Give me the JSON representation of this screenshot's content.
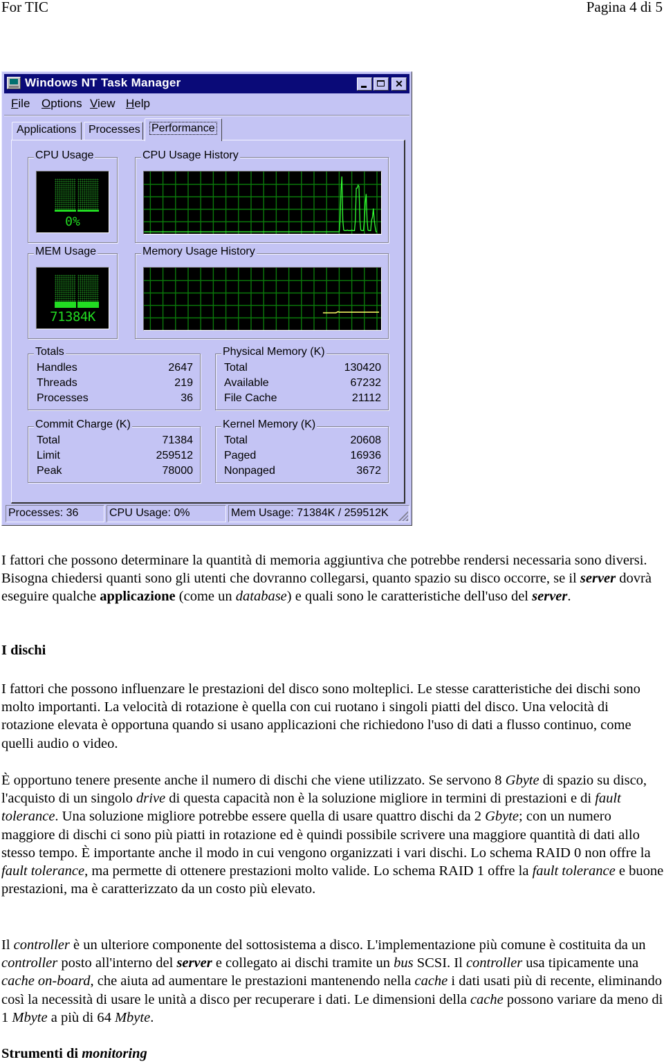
{
  "page_header": {
    "left": "For TIC",
    "right": "Pagina 4 di 5"
  },
  "task_manager": {
    "title": "Windows NT Task Manager",
    "title_buttons": [
      "minimize",
      "maximize",
      "close"
    ],
    "menu": [
      {
        "accel": "F",
        "rest": "ile"
      },
      {
        "accel": "O",
        "rest": "ptions"
      },
      {
        "accel": "V",
        "rest": "iew"
      },
      {
        "accel": "H",
        "rest": "elp"
      }
    ],
    "tabs": [
      "Applications",
      "Processes",
      "Performance"
    ],
    "active_tab": "Performance",
    "cpu_usage": {
      "label": "CPU Usage",
      "value_text": "0%",
      "percent": 0
    },
    "cpu_history": {
      "label": "CPU Usage History",
      "line_color": "#33ff33",
      "recent_samples_percent": [
        0,
        0,
        0,
        0,
        0,
        0,
        0,
        0,
        0,
        0,
        0,
        0,
        0,
        0,
        0,
        0,
        0,
        0,
        0,
        0,
        0,
        0,
        0,
        0,
        0,
        0,
        0,
        0,
        0,
        0,
        0,
        0,
        0,
        0,
        0,
        0,
        0,
        0,
        0,
        0,
        0,
        0,
        0,
        0,
        0,
        0,
        0,
        0,
        0,
        0,
        0,
        0,
        0,
        0,
        0,
        0,
        0,
        0,
        0,
        0,
        0,
        0,
        0,
        0,
        0,
        0,
        0,
        0,
        0,
        0,
        0,
        0,
        0,
        0,
        0,
        0,
        0,
        0,
        0,
        0,
        0,
        0,
        0,
        0,
        0,
        0,
        0,
        0,
        0,
        0,
        0,
        0,
        0,
        0,
        0,
        0,
        0,
        0,
        0,
        0,
        0,
        0,
        0,
        0,
        0,
        0,
        0,
        0,
        0,
        0,
        0,
        0,
        0,
        0,
        0,
        0,
        0,
        0,
        0,
        0,
        0,
        0,
        0,
        0,
        0,
        0,
        0,
        0,
        0,
        0,
        0,
        0,
        0,
        0,
        0,
        0,
        0,
        0,
        0,
        0,
        0,
        0,
        0,
        0,
        0,
        0,
        0,
        0,
        0,
        0,
        0,
        0,
        0,
        0,
        0,
        0,
        0,
        0,
        0,
        0,
        0,
        0,
        0,
        0,
        0,
        0,
        0,
        0,
        0,
        0,
        0,
        0,
        0,
        0,
        0,
        0,
        0,
        0,
        0,
        0,
        0,
        0,
        0,
        0,
        0,
        0,
        0,
        0,
        0,
        0,
        0,
        0,
        0,
        0,
        0,
        0,
        0,
        0,
        0,
        0,
        0,
        0,
        0,
        0,
        0,
        0,
        0,
        0,
        0,
        0,
        0,
        0,
        0,
        0,
        0,
        0,
        0,
        0,
        0,
        0,
        0,
        0,
        0,
        0,
        0,
        0,
        0,
        0,
        0,
        0,
        0,
        0,
        0,
        0,
        0,
        0,
        0,
        0,
        0,
        0,
        0,
        0,
        0,
        0,
        0,
        0,
        0,
        0,
        0,
        0,
        0,
        0,
        0,
        0,
        0,
        0,
        0,
        0,
        0,
        0,
        0,
        0,
        0,
        0,
        0,
        0,
        0,
        0,
        0,
        0,
        0,
        0,
        0,
        0,
        0,
        0,
        0,
        0,
        0,
        0,
        0,
        0,
        0,
        0,
        0,
        0,
        0,
        0,
        0,
        0,
        0,
        0,
        0,
        0,
        0,
        0,
        0,
        20,
        70,
        95,
        20,
        3,
        2,
        2,
        2,
        3,
        2,
        2,
        2,
        2,
        3,
        2,
        2,
        2,
        20,
        75,
        75,
        80,
        78,
        20,
        3,
        2,
        2,
        2,
        20,
        50,
        65,
        20,
        3,
        2,
        2,
        2,
        20,
        25,
        40,
        20,
        8,
        0,
        0
      ]
    },
    "mem_usage": {
      "label": "MEM Usage",
      "value_text": "71384K",
      "fraction": 0.275
    },
    "mem_history": {
      "label": "Memory Usage History",
      "line_color": "#ffff66",
      "recent_samples_percent": [
        26,
        26,
        26,
        26,
        26,
        26,
        26,
        26,
        26,
        26,
        26,
        26,
        27,
        28,
        27,
        27,
        27,
        27,
        27,
        27,
        27,
        27,
        27,
        27,
        27,
        27,
        27,
        27,
        27,
        27,
        27,
        27,
        27,
        27,
        27,
        27,
        27,
        27,
        27,
        27,
        27,
        27,
        27,
        27,
        27,
        27,
        27,
        27,
        27
      ]
    },
    "totals": {
      "label": "Totals",
      "rows": [
        {
          "k": "Handles",
          "v": "2647"
        },
        {
          "k": "Threads",
          "v": "219"
        },
        {
          "k": "Processes",
          "v": "36"
        }
      ]
    },
    "physical_memory": {
      "label": "Physical Memory (K)",
      "rows": [
        {
          "k": "Total",
          "v": "130420"
        },
        {
          "k": "Available",
          "v": "67232"
        },
        {
          "k": "File Cache",
          "v": "21112"
        }
      ]
    },
    "commit_charge": {
      "label": "Commit Charge (K)",
      "rows": [
        {
          "k": "Total",
          "v": "71384"
        },
        {
          "k": "Limit",
          "v": "259512"
        },
        {
          "k": "Peak",
          "v": "78000"
        }
      ]
    },
    "kernel_memory": {
      "label": "Kernel Memory (K)",
      "rows": [
        {
          "k": "Total",
          "v": "20608"
        },
        {
          "k": "Paged",
          "v": "16936"
        },
        {
          "k": "Nonpaged",
          "v": "3672"
        }
      ]
    },
    "status_bar": {
      "processes": "Processes: 36",
      "cpu": "CPU Usage: 0%",
      "mem": "Mem Usage: 71384K / 259512K"
    },
    "colors": {
      "window_bg": "#c4c4f4",
      "titlebar": "#0a0a78",
      "graph_grid": "#0b7a0b",
      "gauge_green": "#22dd22"
    }
  },
  "document": {
    "p1": [
      {
        "t": "I fattori che possono determinare la quantità di memoria aggiuntiva che potrebbe rendersi necessaria sono diversi. Bisogna chiedersi quanti sono gli utenti che dovranno collegarsi, quanto spazio su disco occorre, se il "
      },
      {
        "t": "server",
        "s": "bi"
      },
      {
        "t": " dovrà eseguire qualche "
      },
      {
        "t": "applicazione",
        "s": "b"
      },
      {
        "t": " (come un "
      },
      {
        "t": "database",
        "s": "i"
      },
      {
        "t": ") e quali sono le caratteristiche dell'uso del "
      },
      {
        "t": "server",
        "s": "bi"
      },
      {
        "t": "."
      }
    ],
    "h1": "I dischi",
    "p2": [
      {
        "t": "I fattori che possono influenzare le prestazioni del disco sono molteplici. Le stesse caratteristiche dei dischi sono molto importanti. La velocità di rotazione è quella con cui ruotano i singoli piatti del disco. Una velocità di rotazione elevata è opportuna quando si usano applicazioni che richiedono l'uso di dati a flusso continuo, come quelli audio o video."
      }
    ],
    "p3": [
      {
        "t": "È opportuno tenere presente anche il numero di dischi che viene utilizzato. Se servono 8 "
      },
      {
        "t": "Gbyte",
        "s": "i"
      },
      {
        "t": " di spazio su disco, l'acquisto di un singolo "
      },
      {
        "t": "drive",
        "s": "i"
      },
      {
        "t": " di questa capacità non è la soluzione migliore in termini di prestazioni e di "
      },
      {
        "t": "fault tolerance",
        "s": "i"
      },
      {
        "t": ". Una soluzione migliore potrebbe essere quella di usare quattro dischi da 2 "
      },
      {
        "t": "Gbyte",
        "s": "i"
      },
      {
        "t": "; con un numero maggiore di dischi ci sono più piatti in rotazione ed è quindi possibile scrivere una maggiore quantità di dati allo stesso tempo. È importante anche il modo in cui vengono organizzati i vari dischi. Lo schema RAID 0 non offre la "
      },
      {
        "t": "fault tolerance",
        "s": "i"
      },
      {
        "t": ", ma permette di ottenere prestazioni molto valide. Lo schema RAID 1 offre la "
      },
      {
        "t": "fault tolerance",
        "s": "i"
      },
      {
        "t": " e buone prestazioni, ma è caratterizzato da un costo più elevato."
      }
    ],
    "p4": [
      {
        "t": "Il "
      },
      {
        "t": "controller",
        "s": "i"
      },
      {
        "t": " è un ulteriore componente del sottosistema a disco. L'implementazione più comune è costituita da un "
      },
      {
        "t": "controller",
        "s": "i"
      },
      {
        "t": " posto all'interno del "
      },
      {
        "t": "server",
        "s": "bi"
      },
      {
        "t": " e collegato ai dischi tramite un "
      },
      {
        "t": "bus",
        "s": "i"
      },
      {
        "t": " SCSI. Il "
      },
      {
        "t": "controller",
        "s": "i"
      },
      {
        "t": " usa tipicamente una "
      },
      {
        "t": "cache on-board",
        "s": "i"
      },
      {
        "t": ", che aiuta ad aumentare le prestazioni mantenendo nella "
      },
      {
        "t": "cache",
        "s": "i"
      },
      {
        "t": " i dati usati più di recente, eliminando così la necessità di usare le unità a disco per recuperare i dati. Le dimensioni della "
      },
      {
        "t": "cache",
        "s": "i"
      },
      {
        "t": " possono variare da meno di 1 "
      },
      {
        "t": "Mbyte",
        "s": "i"
      },
      {
        "t": " a più di 64 "
      },
      {
        "t": "Mbyte",
        "s": "i"
      },
      {
        "t": "."
      }
    ],
    "h2": [
      {
        "t": "Strumenti di "
      },
      {
        "t": "monitoring",
        "s": "i"
      }
    ]
  }
}
